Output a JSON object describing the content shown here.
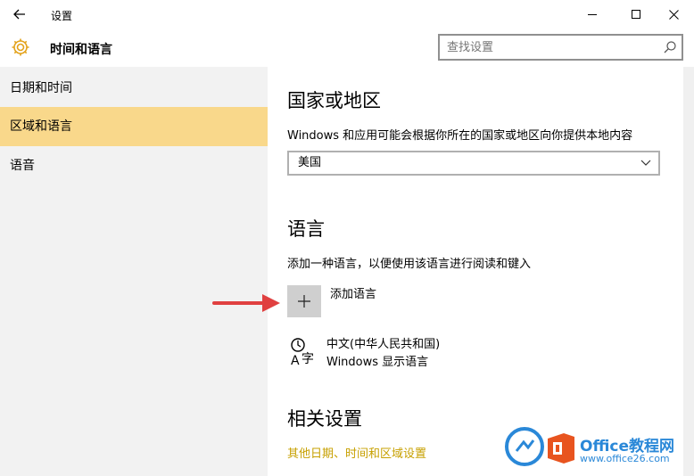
{
  "window": {
    "title": "设置",
    "back_icon": "back-arrow-icon",
    "minimize_icon": "minimize-icon",
    "maximize_icon": "maximize-icon",
    "close_icon": "close-icon"
  },
  "header": {
    "app_title": "时间和语言",
    "icon": "gear-icon"
  },
  "search": {
    "placeholder": "查找设置",
    "icon": "search-icon"
  },
  "sidebar": {
    "items": [
      {
        "label": "日期和时间",
        "active": false
      },
      {
        "label": "区域和语言",
        "active": true
      },
      {
        "label": "语音",
        "active": false
      }
    ],
    "active_color": "#f9d88b"
  },
  "main": {
    "region": {
      "heading": "国家或地区",
      "description": "Windows 和应用可能会根据你所在的国家或地区向你提供本地内容",
      "selected": "美国"
    },
    "language": {
      "heading": "语言",
      "description": "添加一种语言，以便使用该语言进行阅读和键入",
      "add_label": "添加语言",
      "items": [
        {
          "name": "中文(中华人民共和国)",
          "sub": "Windows 显示语言",
          "icon": "language-icon"
        }
      ]
    },
    "related": {
      "heading": "相关设置",
      "link": "其他日期、时间和区域设置",
      "link_color": "#c7a000"
    }
  },
  "annotation": {
    "arrow_color": "#e04040"
  },
  "watermark": {
    "line1": "Office教程网",
    "line2": "www.office26.com"
  }
}
